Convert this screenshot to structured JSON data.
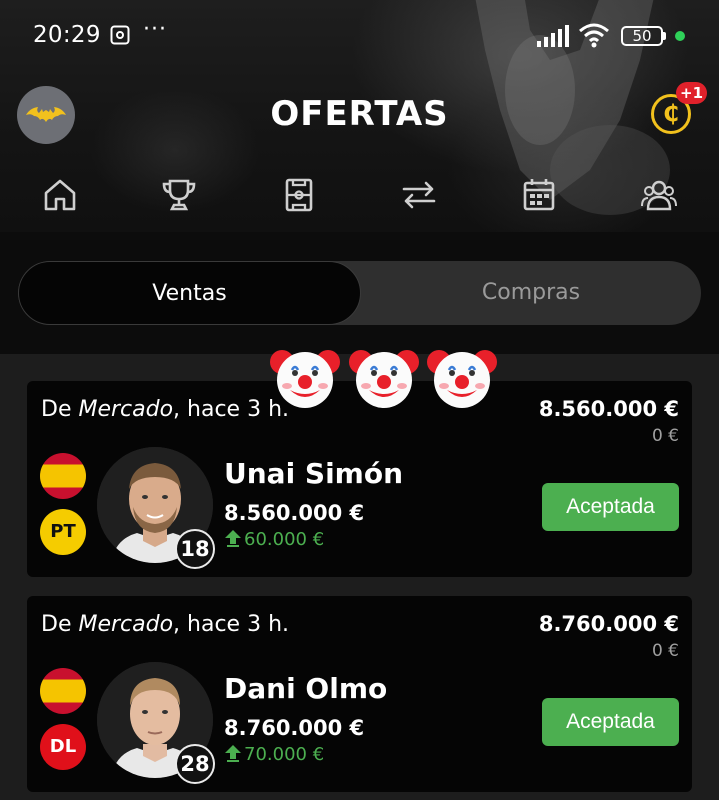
{
  "status_bar": {
    "time": "20:29",
    "dots": "···",
    "battery": "50",
    "icons": [
      "screen-record-icon",
      "signal-icon",
      "wifi-icon",
      "battery-icon"
    ]
  },
  "header": {
    "title": "OFERTAS",
    "coin_symbol": "₵",
    "coin_badge": "+1",
    "avatar_icon": "batman-logo-icon"
  },
  "nav": {
    "items": [
      "home-icon",
      "trophy-icon",
      "lineup-icon",
      "transfers-icon",
      "calendar-icon",
      "users-icon"
    ]
  },
  "tabs": [
    {
      "label": "Ventas",
      "active": true
    },
    {
      "label": "Compras",
      "active": false
    }
  ],
  "overlay": {
    "emojis": [
      "clown-face-icon",
      "clown-face-icon",
      "clown-face-icon"
    ]
  },
  "offers": [
    {
      "origin_prefix": "De ",
      "origin_source": "Mercado",
      "origin_suffix": ", hace 3 h.",
      "price": "8.560.000 €",
      "sub_price": "0 €",
      "country": "Spain",
      "position": "PT",
      "player_name": "Unai Simón",
      "player_number": "18",
      "player_value": "8.560.000 €",
      "value_change": "60.000 €",
      "status": "Aceptada"
    },
    {
      "origin_prefix": "De ",
      "origin_source": "Mercado",
      "origin_suffix": ", hace 3 h.",
      "price": "8.760.000 €",
      "sub_price": "0 €",
      "country": "Spain",
      "position": "DL",
      "player_name": "Dani Olmo",
      "player_number": "28",
      "player_value": "8.760.000 €",
      "value_change": "70.000 €",
      "status": "Aceptada"
    }
  ],
  "colors": {
    "accept_green": "#4caf50",
    "change_green": "#4caf50",
    "coin_gold": "#f2c11d",
    "badge_red": "#e0212b",
    "pos_pt": "#f5cc00",
    "pos_dl": "#e0101a"
  }
}
